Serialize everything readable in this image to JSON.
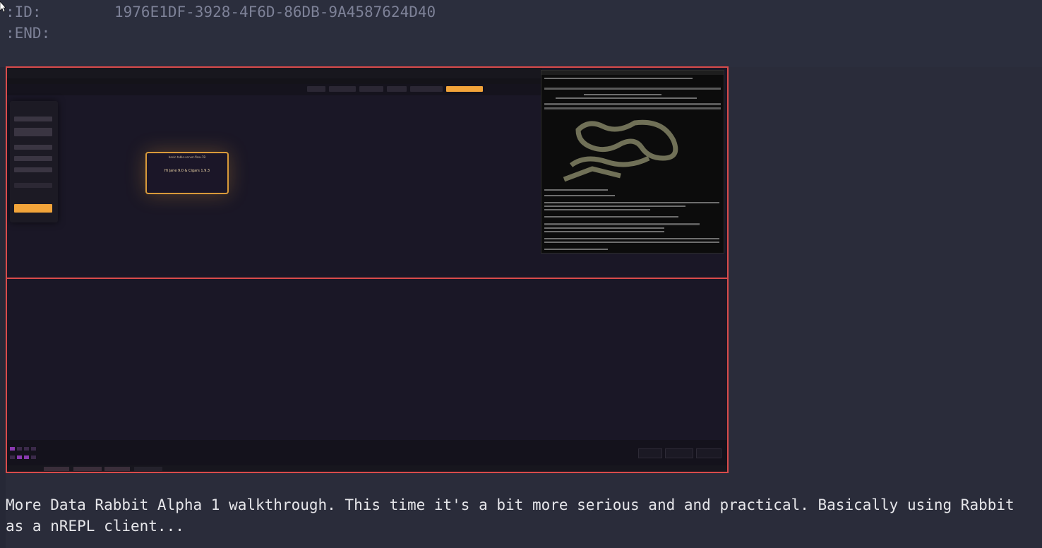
{
  "properties": {
    "id_key": ":ID:",
    "id_value": "1976E1DF-3928-4F6D-86DB-9A4587624D40",
    "end_key": ":END:"
  },
  "embedded_screenshot": {
    "node_title": "basic-table-server-flow-7B",
    "node_text": "Hi Jane 9.0 & Cigars 1.9.3"
  },
  "description": "More Data Rabbit Alpha 1 walkthrough. This time it's a bit more serious and and practical. Basically using Rabbit as a nREPL client...",
  "colors": {
    "background": "#2a2c3a",
    "property_text": "#7d8197",
    "outline": "#d94b4b",
    "accent_orange": "#f2a43a"
  }
}
